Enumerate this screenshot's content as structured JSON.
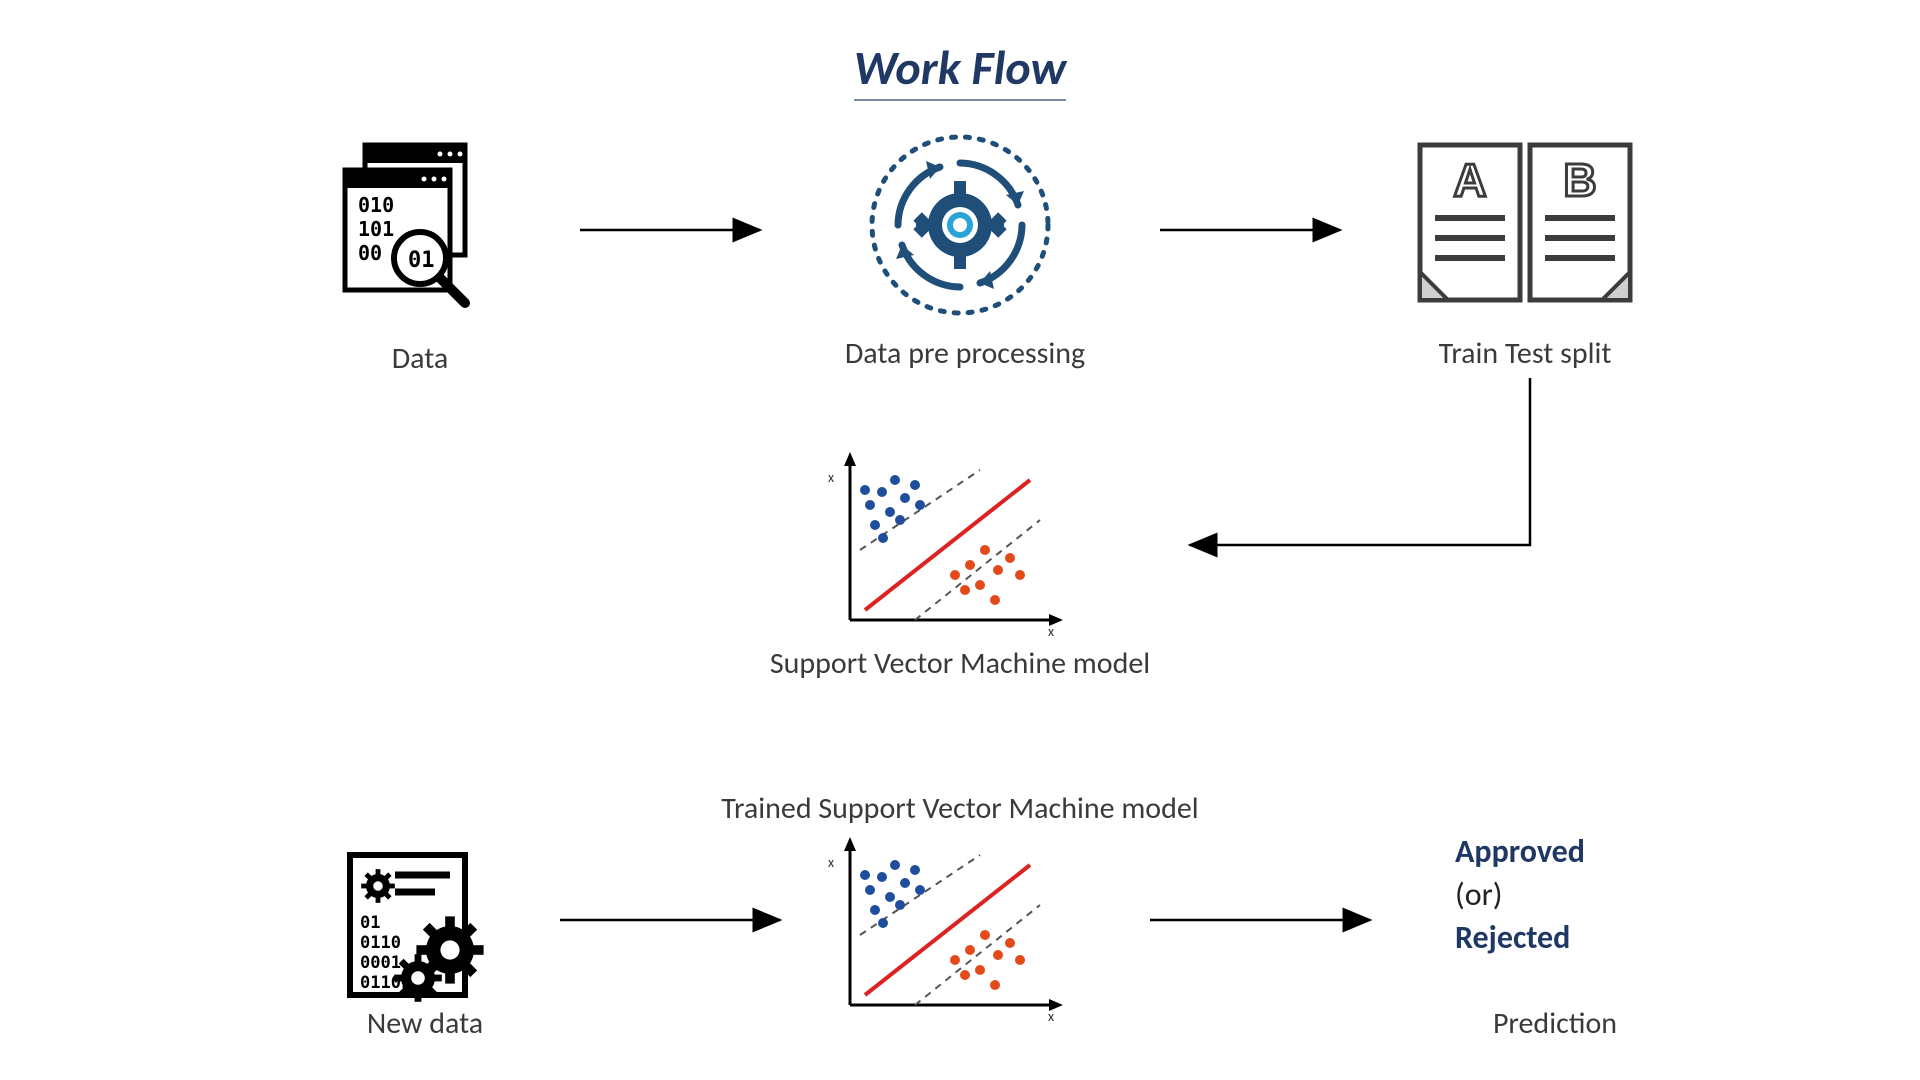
{
  "title": "Work Flow",
  "nodes": {
    "data": "Data",
    "preprocessing": "Data pre processing",
    "train_test_split": "Train Test split",
    "svm_model": "Support Vector Machine model",
    "trained_svm_model": "Trained Support Vector Machine model",
    "new_data": "New data",
    "prediction_label": "Prediction"
  },
  "prediction": {
    "approved": "Approved",
    "or": "(or)",
    "rejected": "Rejected"
  },
  "icons": {
    "data": "data-search-icon",
    "preprocessing": "gear-cycle-icon",
    "train_test_split": "ab-documents-icon",
    "svm": "svm-plot-icon",
    "new_data": "new-data-gears-icon"
  },
  "doc_letters": {
    "a": "A",
    "b": "B"
  },
  "axis_labels": {
    "x": "x",
    "y": "x"
  }
}
